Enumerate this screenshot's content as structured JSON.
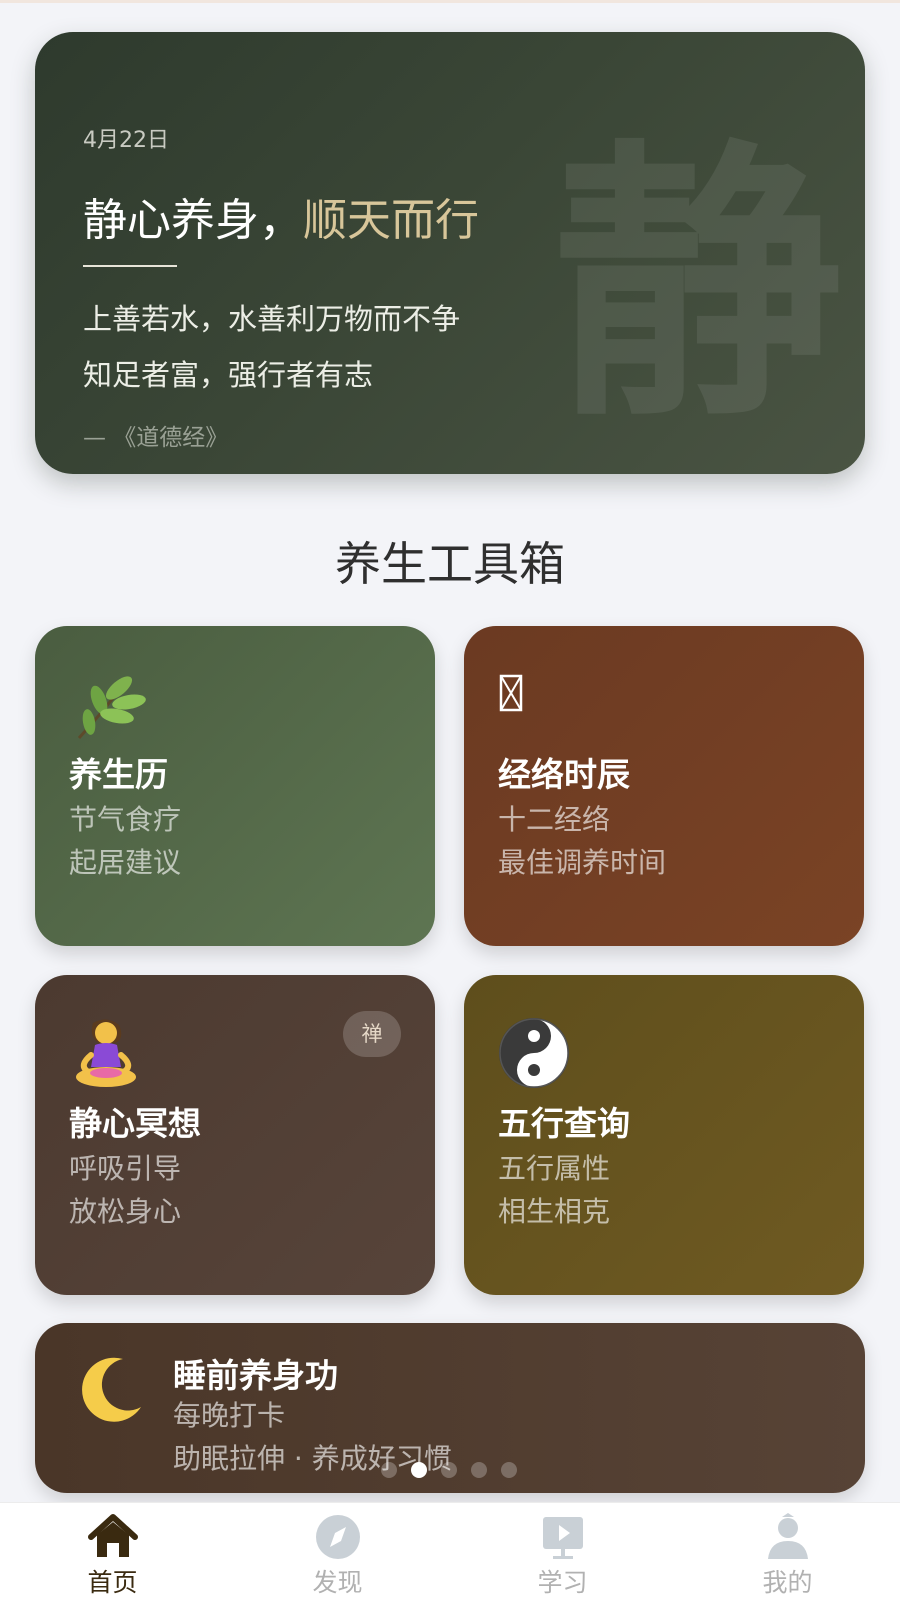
{
  "hero": {
    "date": "4月22日",
    "title_main": "静心养身，",
    "title_accent": "顺天而行",
    "line1": "上善若水，水善利万物而不争",
    "line2": "知足者富，强行者有志",
    "source": "— 《道德经》",
    "watermark": "静"
  },
  "section": {
    "title": "养生工具箱"
  },
  "cards": [
    {
      "icon": "leaf-icon",
      "title": "养生历",
      "line1": "节气食疗",
      "line2": "起居建议",
      "color": "#566d4b"
    },
    {
      "icon": "missing-glyph-icon",
      "title": "经络时辰",
      "line1": "十二经络",
      "line2": "最佳调养时间",
      "color": "#743f24"
    },
    {
      "icon": "meditation-person-icon",
      "title": "静心冥想",
      "line1": "呼吸引导",
      "line2": "放松身心",
      "badge": "禅",
      "color": "#523f34"
    },
    {
      "icon": "yin-yang-icon",
      "title": "五行查询",
      "line1": "五行属性",
      "line2": "相生相克",
      "color": "#685520"
    }
  ],
  "wide_card": {
    "icon": "crescent-moon-icon",
    "title": "睡前养身功",
    "line1": "每晚打卡",
    "line2": "助眠拉伸 · 养成好习惯"
  },
  "pager": {
    "count": 5,
    "active_index": 1
  },
  "tabbar": [
    {
      "label": "首页",
      "icon": "home-icon",
      "active": true
    },
    {
      "label": "发现",
      "icon": "compass-icon",
      "active": false
    },
    {
      "label": "学习",
      "icon": "study-board-icon",
      "active": false
    },
    {
      "label": "我的",
      "icon": "profile-icon",
      "active": false
    }
  ],
  "colors": {
    "accent_gold": "#d8c69a",
    "tab_active": "#3a2a10",
    "tab_inactive": "#b1b1b1"
  }
}
